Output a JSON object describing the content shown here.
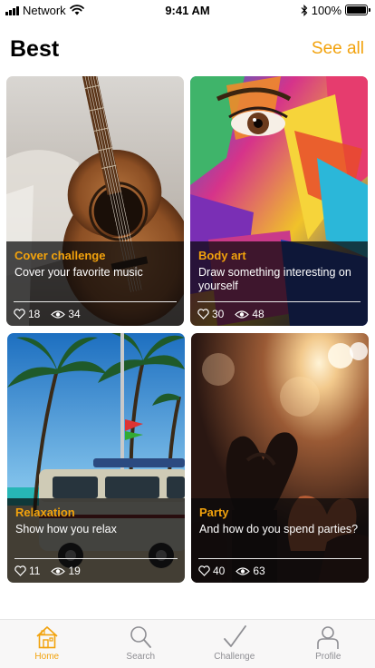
{
  "status_bar": {
    "carrier": "Network",
    "time": "9:41 AM",
    "battery_text": "100%",
    "battery_level": 1.0,
    "icons": [
      "signal-icon",
      "wifi-icon",
      "bluetooth-icon",
      "battery-icon"
    ]
  },
  "header": {
    "title": "Best",
    "see_all_label": "See all"
  },
  "colors": {
    "accent": "#f2a20c",
    "overlay": "#08080a",
    "tab_inactive": "#8e8e93"
  },
  "cards": [
    {
      "title": "Cover challenge",
      "description": "Cover your favorite music",
      "likes": "18",
      "views": "34",
      "image": "guitar-photo"
    },
    {
      "title": "Body art",
      "description": "Draw something interesting on yourself",
      "likes": "30",
      "views": "48",
      "image": "painted-face-photo"
    },
    {
      "title": "Relaxation",
      "description": "Show how you relax",
      "likes": "11",
      "views": "19",
      "image": "beach-van-photo"
    },
    {
      "title": "Party",
      "description": "And how do you spend parties?",
      "likes": "40",
      "views": "63",
      "image": "concert-hands-photo"
    }
  ],
  "tab_bar": {
    "active": "home",
    "tabs": [
      {
        "label": "Home",
        "icon": "home-icon"
      },
      {
        "label": "Search",
        "icon": "search-icon"
      },
      {
        "label": "Challenge",
        "icon": "checkmark-icon"
      },
      {
        "label": "Profile",
        "icon": "profile-icon"
      }
    ]
  }
}
